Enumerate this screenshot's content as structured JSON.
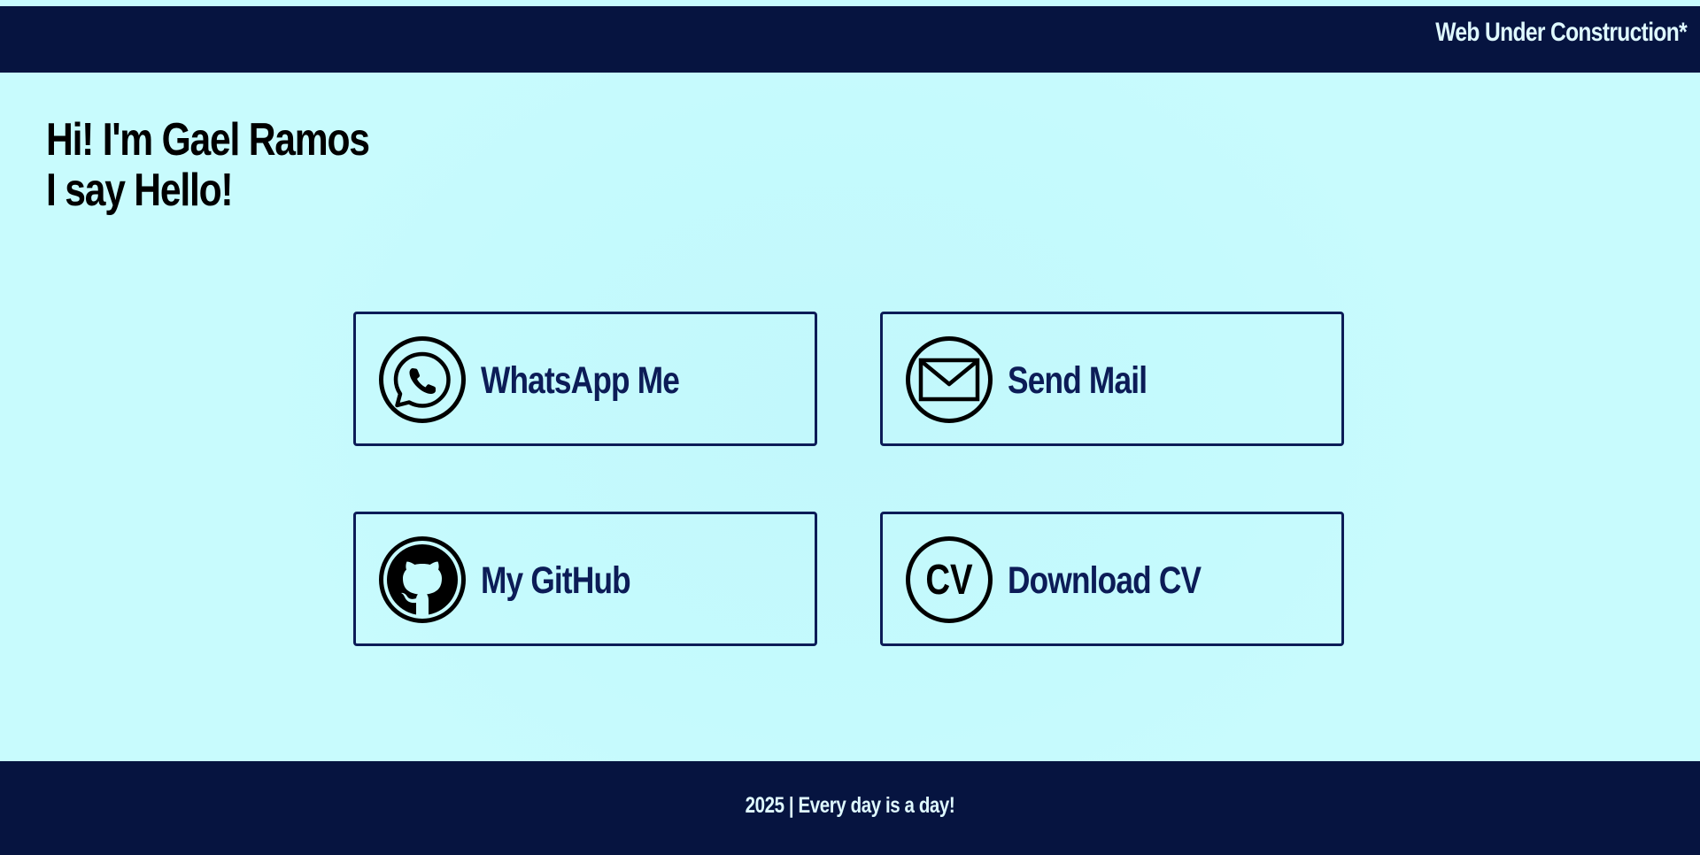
{
  "header": {
    "title": "Web Under Construction*"
  },
  "hero": {
    "line1": "Hi! I'm Gael Ramos",
    "line2": "I say Hello!"
  },
  "cards": [
    {
      "label": "WhatsApp Me",
      "icon": "whatsapp-icon"
    },
    {
      "label": "Send Mail",
      "icon": "mail-icon"
    },
    {
      "label": "My GitHub",
      "icon": "github-icon"
    },
    {
      "label": "Download CV",
      "icon": "cv-icon",
      "icon_text": "CV"
    }
  ],
  "footer": {
    "text": "2025 | Every day is a day!"
  },
  "colors": {
    "background": "#c7fbfd",
    "header_bg": "#061440",
    "accent": "#0c1c57",
    "header_text": "#dff9ff"
  }
}
